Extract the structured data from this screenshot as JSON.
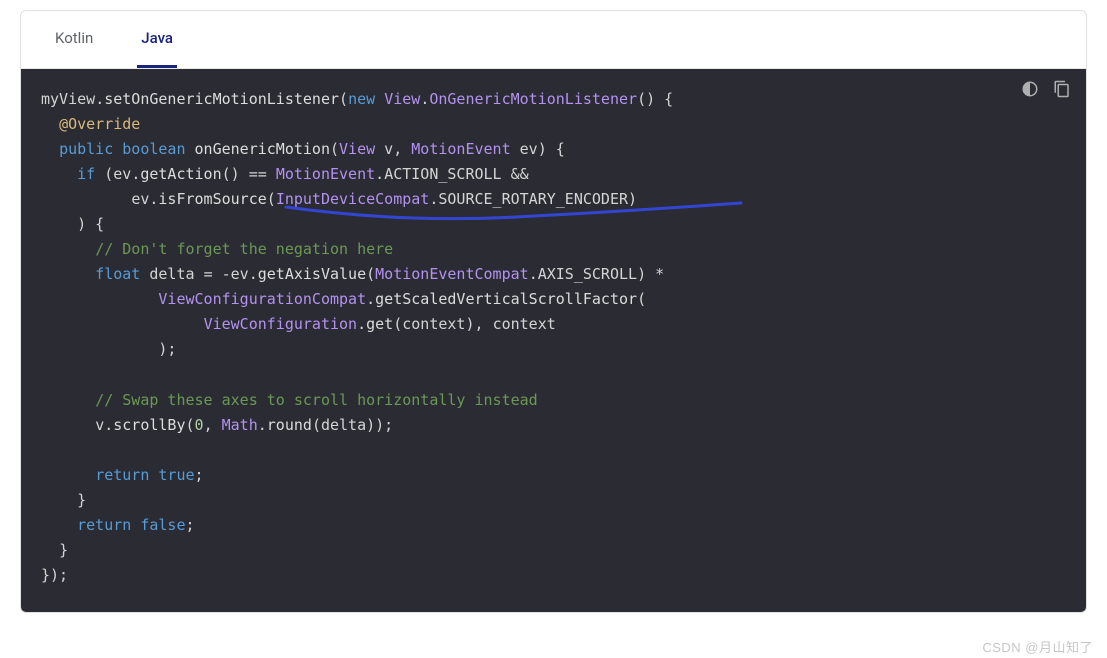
{
  "tabs": {
    "kotlin": "Kotlin",
    "java": "Java"
  },
  "code": {
    "l1": {
      "a": "myView",
      "b": ".",
      "c": "setOnGenericMotionListener",
      "d": "(",
      "e": "new",
      "f": " ",
      "g": "View",
      "h": ".",
      "i": "OnGenericMotionListener",
      "j": "()",
      "k": " {"
    },
    "l2": {
      "a": "@Override"
    },
    "l3": {
      "a": "public",
      "b": " ",
      "c": "boolean",
      "d": " ",
      "e": "onGenericMotion",
      "f": "(",
      "g": "View",
      "h": " v",
      "i": ", ",
      "j": "MotionEvent",
      "k": " ev",
      "l": ") {"
    },
    "l4": {
      "a": "if",
      "b": " (",
      "c": "ev",
      "d": ".",
      "e": "getAction",
      "f": "()",
      "g": " == ",
      "h": "MotionEvent",
      "i": ".",
      "j": "ACTION_SCROLL",
      "k": " &&"
    },
    "l5": {
      "a": "ev",
      "b": ".",
      "c": "isFromSource",
      "d": "(",
      "e": "InputDeviceCompat",
      "f": ".",
      "g": "SOURCE_ROTARY_ENCODER",
      "h": ")"
    },
    "l6": {
      "a": ") {"
    },
    "l7": {
      "a": "// Don't forget the negation here"
    },
    "l8": {
      "a": "float",
      "b": " delta ",
      "c": "=",
      "d": " -",
      "e": "ev",
      "f": ".",
      "g": "getAxisValue",
      "h": "(",
      "i": "MotionEventCompat",
      "j": ".",
      "k": "AXIS_SCROLL",
      "l": ") *"
    },
    "l9": {
      "a": "ViewConfigurationCompat",
      "b": ".",
      "c": "getScaledVerticalScrollFactor",
      "d": "("
    },
    "l10": {
      "a": "ViewConfiguration",
      "b": ".",
      "c": "get",
      "d": "(",
      "e": "context",
      "f": "), ",
      "g": "context"
    },
    "l11": {
      "a": ");"
    },
    "l12": {
      "a": "// Swap these axes to scroll horizontally instead"
    },
    "l13": {
      "a": "v",
      "b": ".",
      "c": "scrollBy",
      "d": "(",
      "e": "0",
      "f": ", ",
      "g": "Math",
      "h": ".",
      "i": "round",
      "j": "(",
      "k": "delta",
      "l": "));"
    },
    "l14": {
      "a": "return",
      "b": " ",
      "c": "true",
      "d": ";"
    },
    "l15": {
      "a": "}"
    },
    "l16": {
      "a": "return",
      "b": " ",
      "c": "false",
      "d": ";"
    },
    "l17": {
      "a": "}"
    },
    "l18": {
      "a": "});"
    }
  },
  "actions": {
    "theme": "toggle-theme",
    "copy": "copy"
  },
  "watermark": "CSDN @月山知了",
  "annotation": {
    "stroke": "#3246d3"
  }
}
